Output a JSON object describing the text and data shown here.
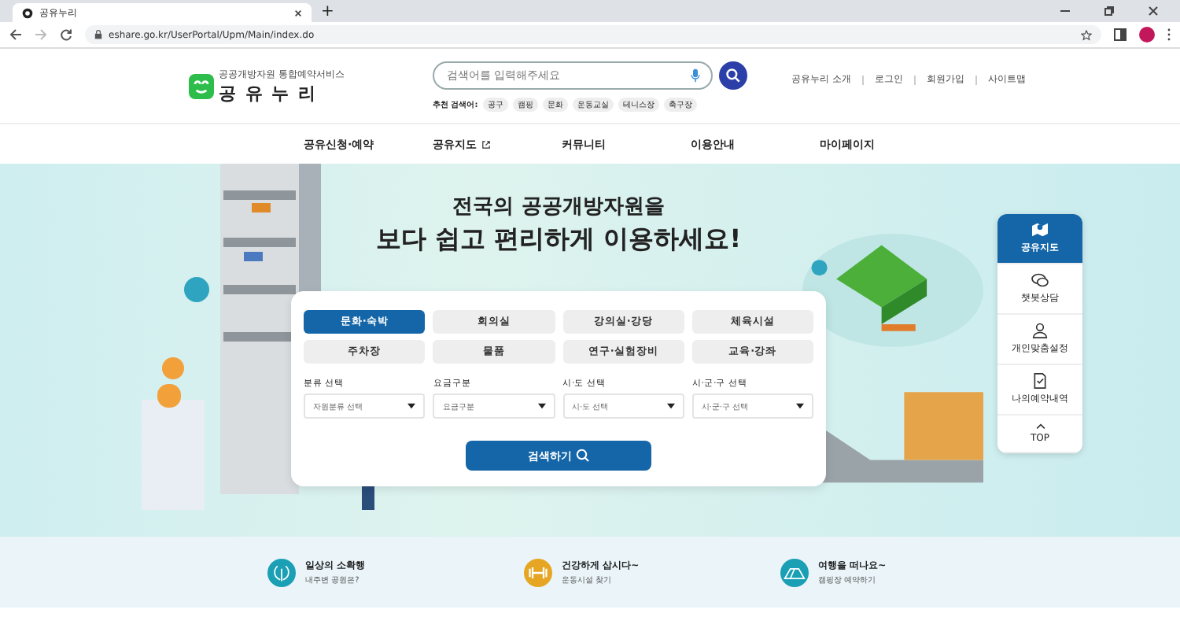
{
  "browser": {
    "tab_title": "공유누리",
    "new_tab": "+",
    "url": "eshare.go.kr/UserPortal/Upm/Main/index.do"
  },
  "header": {
    "logo_subtitle": "공공개방자원 통합예약서비스",
    "logo_title": "공 유 누 리",
    "search_placeholder": "검색어를 입력해주세요",
    "recommend_label": "추천 검색어:",
    "recommend_tags": [
      "공구",
      "캠핑",
      "문화",
      "운동교실",
      "테니스장",
      "축구장"
    ],
    "links": [
      "공유누리 소개",
      "로그인",
      "회원가입",
      "사이트맵"
    ]
  },
  "nav": [
    {
      "label": "공유신청·예약",
      "external": false
    },
    {
      "label": "공유지도",
      "external": true
    },
    {
      "label": "커뮤니티",
      "external": false
    },
    {
      "label": "이용안내",
      "external": false
    },
    {
      "label": "마이페이지",
      "external": false
    }
  ],
  "hero": {
    "line1": "전국의 공공개방자원을",
    "line2": "보다 쉽고 편리하게 이용하세요!"
  },
  "categories": [
    {
      "label": "문화·숙박",
      "selected": true
    },
    {
      "label": "회의실",
      "selected": false
    },
    {
      "label": "강의실·강당",
      "selected": false
    },
    {
      "label": "체육시설",
      "selected": false
    },
    {
      "label": "주차장",
      "selected": false
    },
    {
      "label": "물품",
      "selected": false
    },
    {
      "label": "연구·실험장비",
      "selected": false
    },
    {
      "label": "교육·강좌",
      "selected": false
    }
  ],
  "filters": [
    {
      "label": "분류 선택",
      "value": "자원분류 선택"
    },
    {
      "label": "요금구분",
      "value": "요금구분"
    },
    {
      "label": "시·도 선택",
      "value": "시·도 선택"
    },
    {
      "label": "시·군·구 선택",
      "value": "시·군·구 선택"
    }
  ],
  "search_button": "검색하기",
  "quick_menu": [
    {
      "kind": "map",
      "label": "공유지도",
      "selected": true
    },
    {
      "kind": "chat",
      "label": "챗봇상담",
      "selected": false
    },
    {
      "kind": "person",
      "label": "개인맞춤설정",
      "selected": false
    },
    {
      "kind": "doc",
      "label": "나의예약내역",
      "selected": false
    },
    {
      "kind": "top",
      "label": "TOP",
      "selected": false
    }
  ],
  "banners": [
    {
      "kind": "park",
      "title": "일상의 소확행",
      "subtitle": "내주변 공원은?",
      "color": "#1a9fb5"
    },
    {
      "kind": "gym",
      "title": "건강하게 삽시다~",
      "subtitle": "운동시설 찾기",
      "color": "#e6a623"
    },
    {
      "kind": "camp",
      "title": "여행을 떠나요~",
      "subtitle": "캠핑장 예약하기",
      "color": "#1a9fb5"
    }
  ]
}
